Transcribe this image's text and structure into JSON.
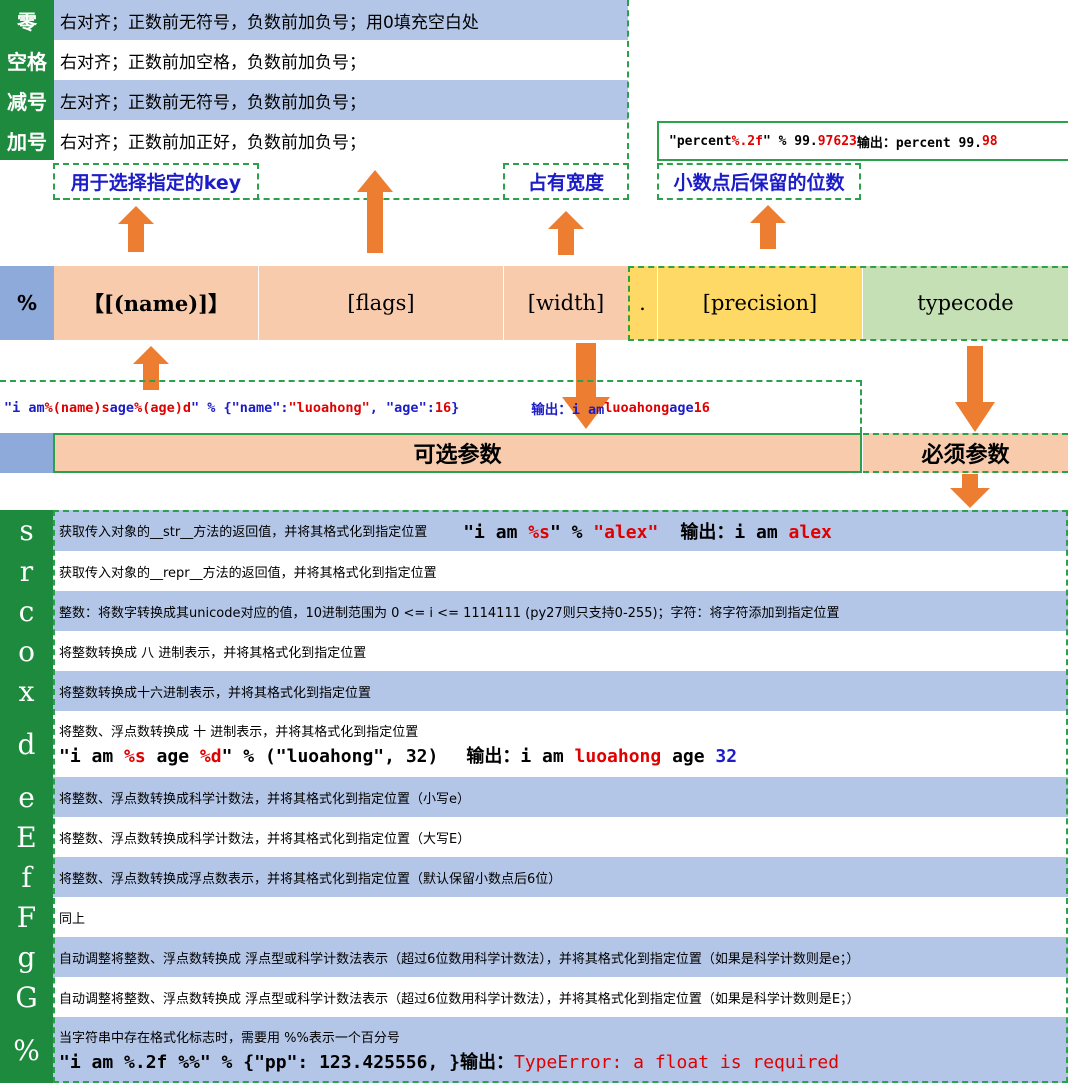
{
  "flags": [
    {
      "name": "零",
      "desc": "右对齐；正数前无符号，负数前加负号；用0填充空白处"
    },
    {
      "name": "空格",
      "desc": "右对齐；正数前加空格，负数前加负号；"
    },
    {
      "name": "减号",
      "desc": "左对齐；正数前无符号，负数前加负号；"
    },
    {
      "name": "加号",
      "desc": "右对齐；正数前加正好，负数前加负号；"
    }
  ],
  "labels": {
    "key": "用于选择指定的key",
    "width": "占有宽度",
    "precision": "小数点后保留的位数"
  },
  "precision_example": {
    "p1": "\"percent ",
    "p2": "%.2f",
    "p3": "\" % 99.",
    "p4": "97623",
    "p5": "输出：percent 99.",
    "p6": "98"
  },
  "format_row": {
    "percent": "%",
    "name": "【[(name)]】",
    "flags": "[flags]",
    "width": "[width]",
    "dot": ".",
    "precision": "[precision]",
    "typecode": "typecode"
  },
  "name_example": {
    "s1": "\"i am ",
    "s2": "%(name)s",
    "s3": " age ",
    "s4": "%(age)d",
    "s5": "\" % {\"name\": ",
    "s6": "\"luoahong\"",
    "s7": ", \"age\": ",
    "s8": "16",
    "s9": "}",
    "out1": "输出：i am ",
    "out2": "luoahong",
    "out3": " age ",
    "out4": "16"
  },
  "optional_label": "可选参数",
  "required_label": "必须参数",
  "typecodes": [
    {
      "code": "s",
      "desc": "获取传入对象的__str__方法的返回值，并将其格式化到指定位置"
    },
    {
      "code": "r",
      "desc": "获取传入对象的__repr__方法的返回值，并将其格式化到指定位置"
    },
    {
      "code": "c",
      "desc": "整数：将数字转换成其unicode对应的值，10进制范围为 0 <= i <= 1114111 (py27则只支持0-255)；字符：将字符添加到指定位置"
    },
    {
      "code": "o",
      "desc": "将整数转换成 八  进制表示，并将其格式化到指定位置"
    },
    {
      "code": "x",
      "desc": "将整数转换成十六进制表示，并将其格式化到指定位置"
    },
    {
      "code": "d",
      "desc": "将整数、浮点数转换成 十 进制表示，并将其格式化到指定位置"
    },
    {
      "code": "e",
      "desc": "将整数、浮点数转换成科学计数法，并将其格式化到指定位置（小写e）"
    },
    {
      "code": "E",
      "desc": "将整数、浮点数转换成科学计数法，并将其格式化到指定位置（大写E）"
    },
    {
      "code": "f",
      "desc": "将整数、浮点数转换成浮点数表示，并将其格式化到指定位置（默认保留小数点后6位）"
    },
    {
      "code": "F",
      "desc": "同上"
    },
    {
      "code": "g",
      "desc": "自动调整将整数、浮点数转换成 浮点型或科学计数法表示（超过6位数用科学计数法），并将其格式化到指定位置（如果是科学计数则是e；）"
    },
    {
      "code": "G",
      "desc": "自动调整将整数、浮点数转换成 浮点型或科学计数法表示（超过6位数用科学计数法），并将其格式化到指定位置（如果是科学计数则是E；）"
    },
    {
      "code": "%",
      "desc": "当字符串中存在格式化标志时，需要用 %%表示一个百分号"
    }
  ],
  "s_example": {
    "e1": "\"i am ",
    "e2": "%s",
    "e3": "\" % ",
    "e4": "\"alex\"",
    "o1": "输出：i am ",
    "o2": "alex"
  },
  "d_example": {
    "e1": "\"i am ",
    "e2": "%s",
    "e3": " age ",
    "e4": "%d",
    "e5": "\" % (\"luoahong\", 32)",
    "o1": "输出：i am ",
    "o2": "luoahong",
    "o3": " age ",
    "o4": "32"
  },
  "pct_example": {
    "e1": "\"i am %.2f %%\" % {\"pp\": 123.425556, }输出：",
    "e2": "TypeError: a float is required"
  },
  "colors": {
    "green": "#1e8a3e",
    "blue": "#b4c6e7",
    "peach": "#f8cbad",
    "yellow": "#ffd966",
    "lightgreen": "#c5e0b4",
    "arrow": "#ed7d31"
  }
}
